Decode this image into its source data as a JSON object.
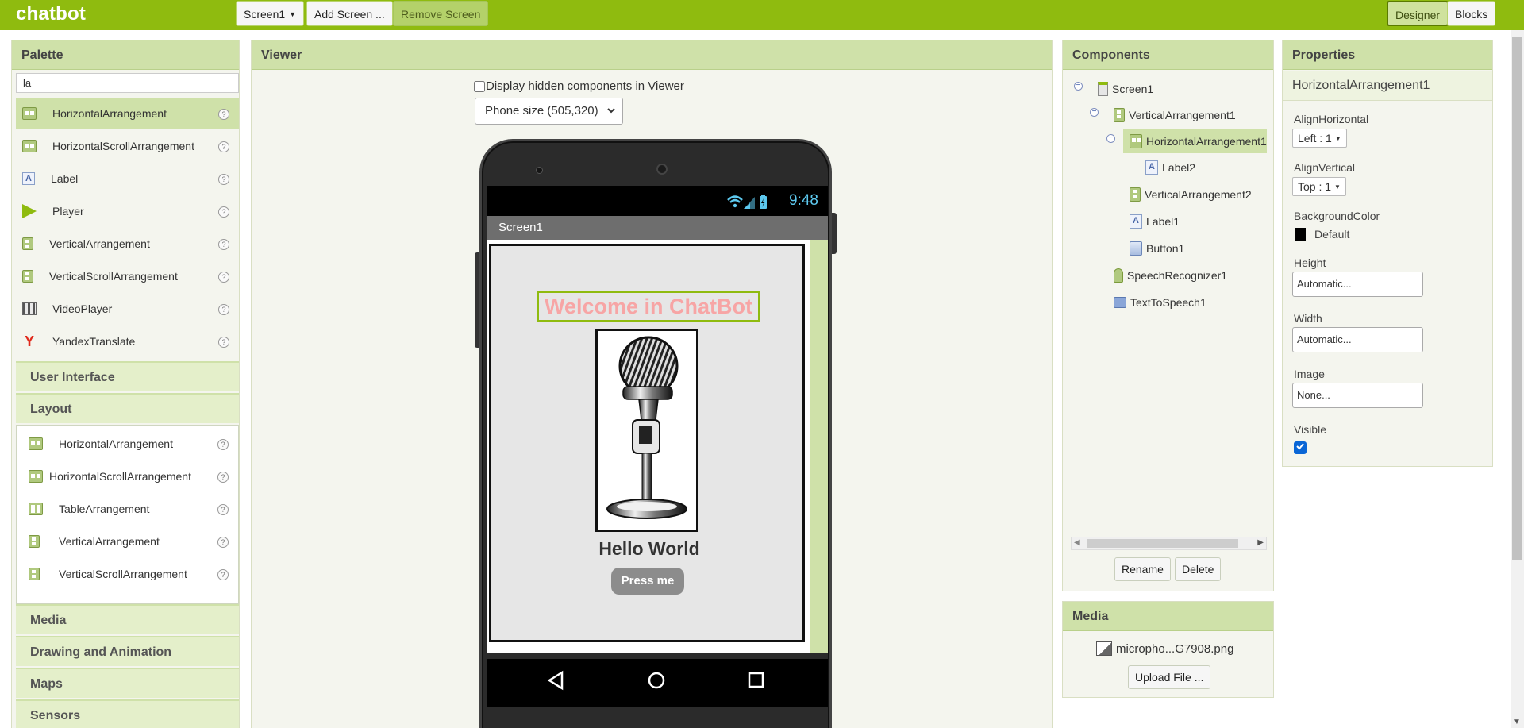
{
  "app": {
    "title": "chatbot"
  },
  "toolbar": {
    "screen_select": "Screen1",
    "add_screen": "Add Screen ...",
    "remove_screen": "Remove Screen",
    "designer": "Designer",
    "blocks": "Blocks"
  },
  "palette": {
    "title": "Palette",
    "search_value": "la",
    "results": [
      {
        "label": "HorizontalArrangement",
        "icon": "horizontal-arrangement-icon",
        "selected": true
      },
      {
        "label": "HorizontalScrollArrangement",
        "icon": "horizontal-scroll-arrangement-icon"
      },
      {
        "label": "Label",
        "icon": "label-icon"
      },
      {
        "label": "Player",
        "icon": "player-icon"
      },
      {
        "label": "VerticalArrangement",
        "icon": "vertical-arrangement-icon"
      },
      {
        "label": "VerticalScrollArrangement",
        "icon": "vertical-scroll-arrangement-icon"
      },
      {
        "label": "VideoPlayer",
        "icon": "video-player-icon"
      },
      {
        "label": "YandexTranslate",
        "icon": "yandex-translate-icon"
      }
    ],
    "categories": {
      "user_interface": "User Interface",
      "layout": "Layout",
      "media": "Media",
      "drawing": "Drawing and Animation",
      "maps": "Maps",
      "sensors": "Sensors"
    },
    "layout_items": [
      {
        "label": "HorizontalArrangement"
      },
      {
        "label": "HorizontalScrollArrangement"
      },
      {
        "label": "TableArrangement"
      },
      {
        "label": "VerticalArrangement"
      },
      {
        "label": "VerticalScrollArrangement"
      }
    ],
    "help": "?"
  },
  "viewer": {
    "title": "Viewer",
    "hidden_checkbox_label": "Display hidden components in Viewer",
    "phone_size": "Phone size (505,320)",
    "phone": {
      "time": "9:48",
      "screen_title": "Screen1",
      "welcome": "Welcome in ChatBot",
      "hello": "Hello World",
      "button": "Press me"
    }
  },
  "components": {
    "title": "Components",
    "tree": {
      "screen1": "Screen1",
      "va1": "VerticalArrangement1",
      "ha1": "HorizontalArrangement1",
      "label2": "Label2",
      "va2": "VerticalArrangement2",
      "label1": "Label1",
      "button1": "Button1",
      "speech": "SpeechRecognizer1",
      "tts": "TextToSpeech1"
    },
    "rename": "Rename",
    "delete": "Delete"
  },
  "media": {
    "title": "Media",
    "file": "micropho...G7908.png",
    "upload": "Upload File ..."
  },
  "properties": {
    "title": "Properties",
    "component": "HorizontalArrangement1",
    "align_horizontal_label": "AlignHorizontal",
    "align_horizontal_value": "Left : 1",
    "align_vertical_label": "AlignVertical",
    "align_vertical_value": "Top : 1",
    "bgcolor_label": "BackgroundColor",
    "bgcolor_value": "Default",
    "height_label": "Height",
    "height_value": "Automatic...",
    "width_label": "Width",
    "width_value": "Automatic...",
    "image_label": "Image",
    "image_value": "None...",
    "visible_label": "Visible",
    "visible_checked": true
  },
  "colors": {
    "accent": "#8fbb0f",
    "panel_header": "#cfe1a9",
    "welcome_text": "#f7a5a5",
    "status_blue": "#5dc8ee"
  }
}
